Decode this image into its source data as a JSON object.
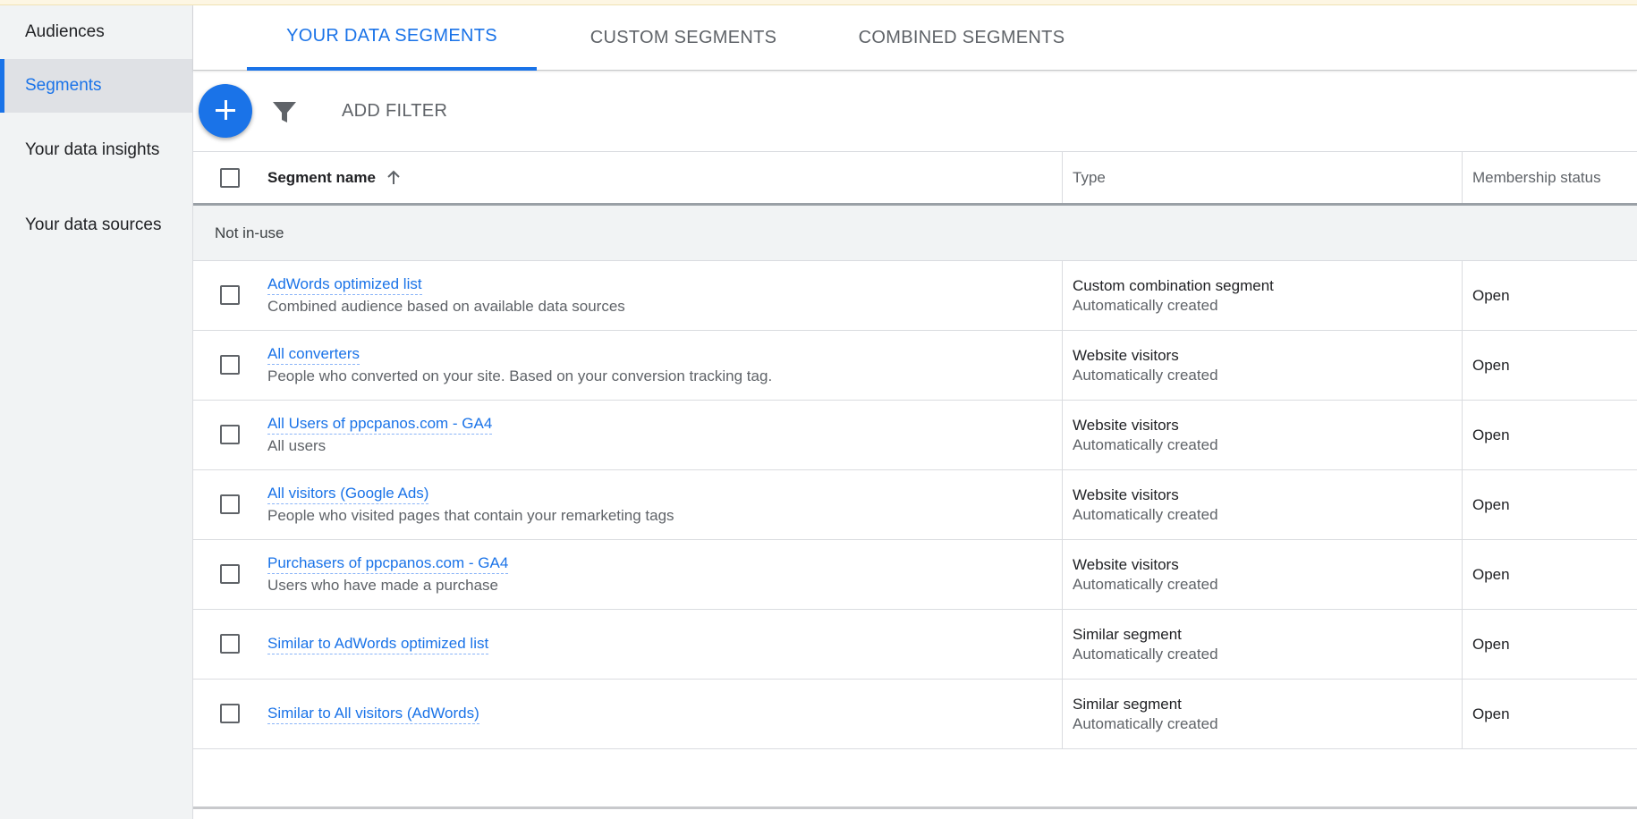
{
  "sidebar": {
    "items": [
      {
        "label": "Audiences"
      },
      {
        "label": "Segments"
      },
      {
        "label": "Your data insights"
      },
      {
        "label": "Your data sources"
      }
    ]
  },
  "tabs": [
    {
      "label": "YOUR DATA SEGMENTS"
    },
    {
      "label": "CUSTOM SEGMENTS"
    },
    {
      "label": "COMBINED SEGMENTS"
    }
  ],
  "toolbar": {
    "add_filter_label": "ADD FILTER"
  },
  "table": {
    "columns": {
      "name": "Segment name",
      "type": "Type",
      "status": "Membership status"
    },
    "group_label": "Not in-use",
    "rows": [
      {
        "name": "AdWords optimized list",
        "desc": "Combined audience based on available data sources",
        "type": "Custom combination segment",
        "type_sub": "Automatically created",
        "status": "Open"
      },
      {
        "name": "All converters",
        "desc": "People who converted on your site. Based on your conversion tracking tag.",
        "type": "Website visitors",
        "type_sub": "Automatically created",
        "status": "Open"
      },
      {
        "name": "All Users of ppcpanos.com - GA4",
        "desc": "All users",
        "type": "Website visitors",
        "type_sub": "Automatically created",
        "status": "Open"
      },
      {
        "name": "All visitors (Google Ads)",
        "desc": "People who visited pages that contain your remarketing tags",
        "type": "Website visitors",
        "type_sub": "Automatically created",
        "status": "Open"
      },
      {
        "name": "Purchasers of ppcpanos.com - GA4",
        "desc": "Users who have made a purchase",
        "type": "Website visitors",
        "type_sub": "Automatically created",
        "status": "Open"
      },
      {
        "name": "Similar to AdWords optimized list",
        "desc": "",
        "type": "Similar segment",
        "type_sub": "Automatically created",
        "status": "Open"
      },
      {
        "name": "Similar to All visitors (AdWords)",
        "desc": "",
        "type": "Similar segment",
        "type_sub": "Automatically created",
        "status": "Open"
      }
    ]
  },
  "colors": {
    "accent": "#1a73e8",
    "sidebar_bg": "#f1f3f4",
    "active_item_bg": "#dfe1e5"
  }
}
